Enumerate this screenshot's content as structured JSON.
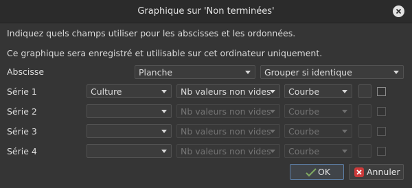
{
  "window": {
    "title": "Graphique sur 'Non terminées'"
  },
  "intro": {
    "line1": "Indiquez quels champs utiliser pour les abscisses et les ordonnées.",
    "line2": "Ce graphique sera enregistré et utilisable sur cet ordinateur uniquement."
  },
  "abscisse": {
    "label": "Abscisse",
    "field": "Planche",
    "grouping": "Grouper si identique"
  },
  "series": [
    {
      "label": "Série 1",
      "field": "Culture",
      "aggregate": "Nb valeurs non vides",
      "type": "Courbe",
      "enabled": true
    },
    {
      "label": "Série 2",
      "field": "",
      "aggregate": "Nb valeurs non vides",
      "type": "Courbe",
      "enabled": false
    },
    {
      "label": "Série 3",
      "field": "",
      "aggregate": "Nb valeurs non vides",
      "type": "Courbe",
      "enabled": false
    },
    {
      "label": "Série 4",
      "field": "",
      "aggregate": "Nb valeurs non vides",
      "type": "Courbe",
      "enabled": false
    }
  ],
  "buttons": {
    "ok": "OK",
    "cancel": "Annuler"
  },
  "colors": {
    "background": "#353535",
    "cancel_icon": "#cc3a3a",
    "ok_icon": "#7ea661"
  }
}
